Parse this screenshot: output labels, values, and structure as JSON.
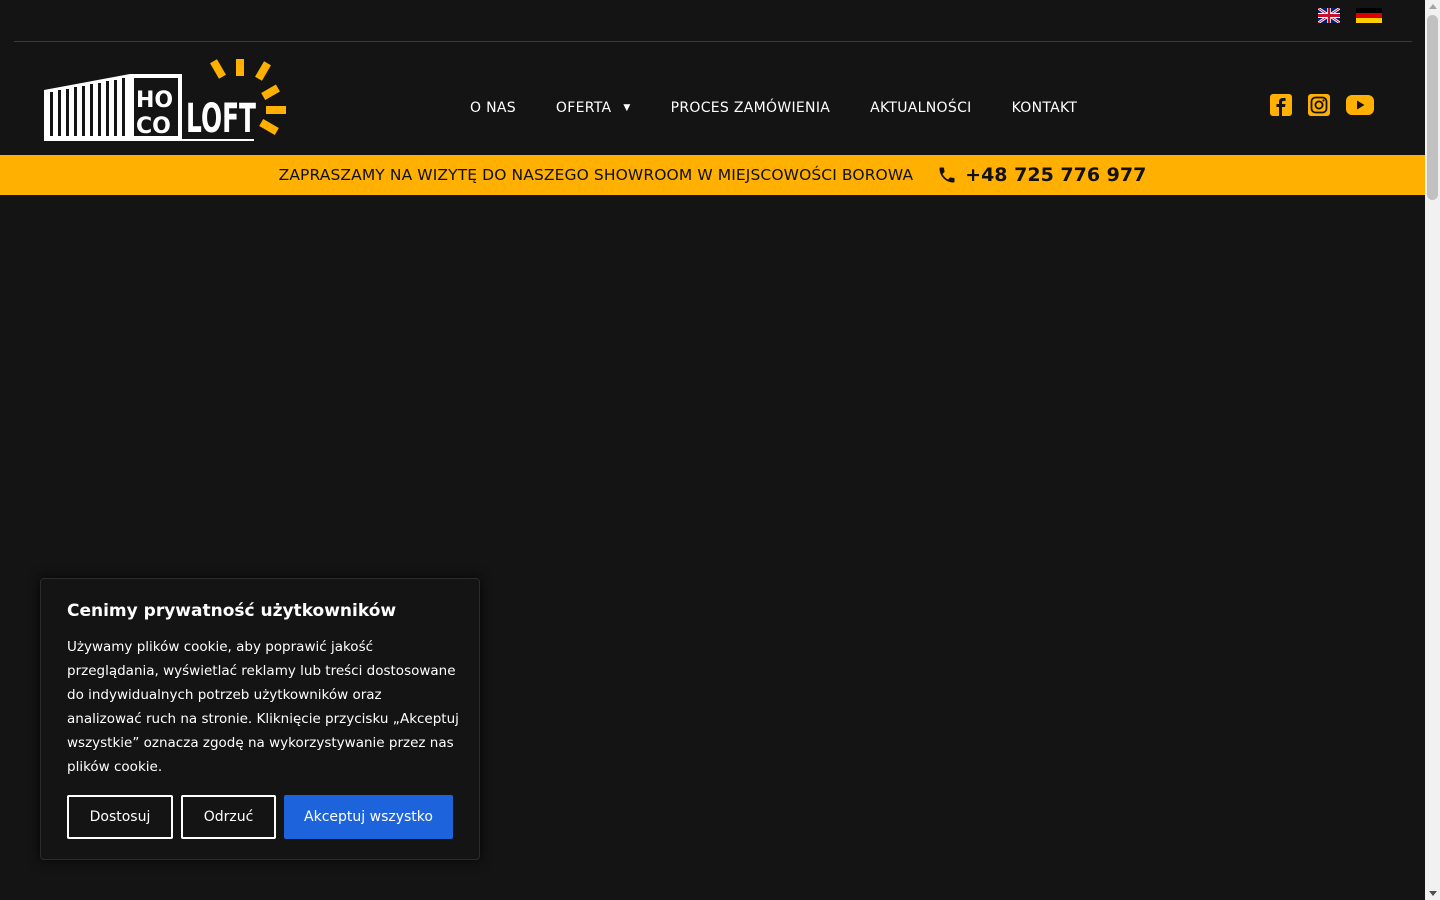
{
  "languages": [
    {
      "name": "English",
      "icon": "uk-flag-icon"
    },
    {
      "name": "Deutsch",
      "icon": "germany-flag-icon"
    }
  ],
  "logo": {
    "line1": "HO",
    "line2": "CO",
    "word": "LOFT",
    "icon": "hocoloft-logo"
  },
  "nav": {
    "items": [
      {
        "label": "O NAS"
      },
      {
        "label": "OFERTA",
        "has_dropdown": true
      },
      {
        "label": "PROCES ZAMÓWIENIA"
      },
      {
        "label": "AKTUALNOŚCI"
      },
      {
        "label": "KONTAKT"
      }
    ],
    "dropdown_caret": "▼"
  },
  "socials": [
    {
      "icon": "facebook-icon"
    },
    {
      "icon": "instagram-icon"
    },
    {
      "icon": "youtube-icon"
    }
  ],
  "banner": {
    "text": "ZAPRASZAMY NA WIZYTĘ DO NASZEGO SHOWROOM W MIEJSCOWOŚCI BOROWA",
    "phone": "+48 725 776 977",
    "phone_icon": "phone-icon"
  },
  "cookie": {
    "title": "Cenimy prywatność użytkowników",
    "text": "Używamy plików cookie, aby poprawić jakość przeglądania, wyświetlać reklamy lub treści dostosowane do indywidualnych potrzeb użytkowników oraz analizować ruch na stronie. Kliknięcie przycisku „Akceptuj wszystkie” oznacza zgodę na wykorzystywanie przez nas plików cookie.",
    "buttons": {
      "customize": "Dostosuj",
      "reject": "Odrzuć",
      "accept": "Akceptuj wszystko"
    }
  },
  "colors": {
    "background": "#141414",
    "accent_yellow": "#ffb000",
    "accept_blue": "#1d63dc",
    "text": "#ffffff"
  }
}
